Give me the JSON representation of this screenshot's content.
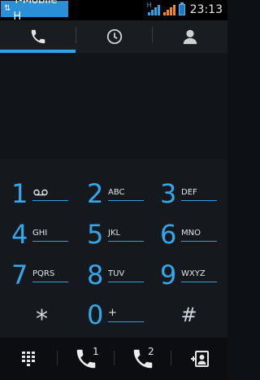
{
  "status_bar": {
    "carrier": "T-Mobile H",
    "network_indicator": "H",
    "time": "23:13",
    "icons": [
      "data-arrows-icon",
      "signal-blue-icon",
      "signal-orange-icon",
      "battery-icon"
    ]
  },
  "tabs": [
    {
      "name": "phone",
      "icon": "phone-icon",
      "selected": true
    },
    {
      "name": "recent",
      "icon": "clock-icon",
      "selected": false
    },
    {
      "name": "contacts",
      "icon": "person-icon",
      "selected": false
    }
  ],
  "keypad": [
    {
      "digit": "1",
      "letters": "",
      "icon": "voicemail-icon"
    },
    {
      "digit": "2",
      "letters": "ABC"
    },
    {
      "digit": "3",
      "letters": "DEF"
    },
    {
      "digit": "4",
      "letters": "GHI"
    },
    {
      "digit": "5",
      "letters": "JKL"
    },
    {
      "digit": "6",
      "letters": "MNO"
    },
    {
      "digit": "7",
      "letters": "PQRS"
    },
    {
      "digit": "8",
      "letters": "TUV"
    },
    {
      "digit": "9",
      "letters": "WXYZ"
    },
    {
      "digit": "*",
      "letters": ""
    },
    {
      "digit": "0",
      "letters": "+"
    },
    {
      "digit": "#",
      "letters": ""
    }
  ],
  "action_bar": {
    "dialpad_icon": "dialpad-icon",
    "call_sim1_label": "1",
    "call_sim2_label": "2",
    "contacts_icon": "add-contact-icon"
  },
  "colors": {
    "accent": "#2fa3e6",
    "carrier_bg": "#2a8fd6",
    "signal_orange": "#f08a1c"
  }
}
